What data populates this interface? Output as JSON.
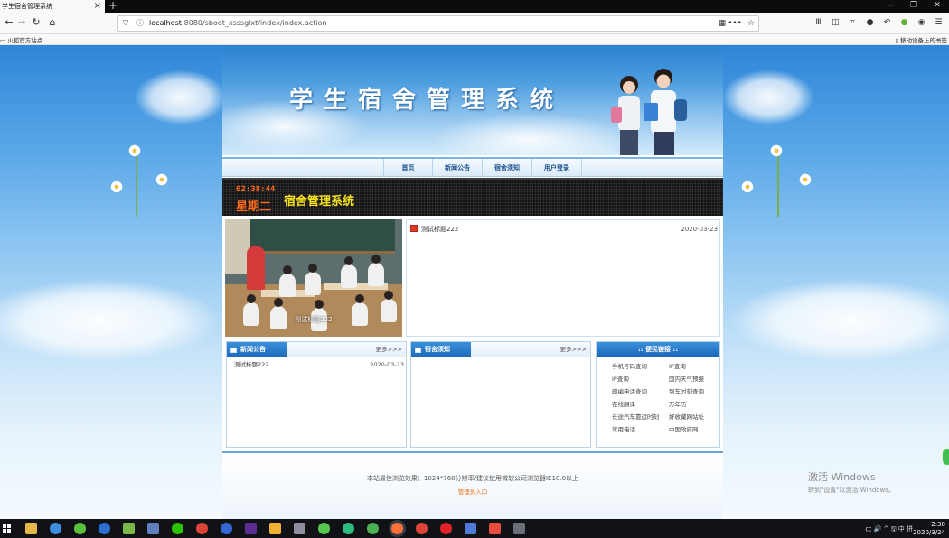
{
  "browser": {
    "tab_title": "学生宿舍管理系统",
    "tab_close": "×",
    "new_tab": "+",
    "window_controls": [
      "—",
      "❐",
      "✕"
    ],
    "nav_icons": [
      "back-icon",
      "forward-icon",
      "reload-icon",
      "home-icon"
    ],
    "url_host": "localhost",
    "url_rest": ":8080/sboot_xsssglxt/index/index.action",
    "url_right_icons": [
      "qr-code-icon",
      "page-actions-icon",
      "bookmark-star-icon"
    ],
    "toolbar_icons": [
      "library-icon",
      "sidebar-icon",
      "screenshot-icon",
      "chat-icon",
      "undo-icon",
      "extension-icon",
      "account-icon",
      "menu-icon"
    ],
    "bookmark_left": "火狐官方站点",
    "bookmark_right": "移动设备上的书签"
  },
  "site": {
    "banner_title": "学生宿舍管理系统",
    "menu": [
      "首页",
      "新闻公告",
      "宿舍须知",
      "用户登录"
    ],
    "clock": {
      "time": "02:38:44",
      "weekday": "星期二",
      "system_name": "宿舍管理系统"
    },
    "slideshow_caption": "测试标题222",
    "top_news": [
      {
        "title": "测试标题222",
        "date": "2020-03-23"
      }
    ],
    "news_panel": {
      "title": "新闻公告",
      "more": "更多>>>",
      "items": [
        {
          "title": "测试标题222",
          "date": "2020-03-23"
        }
      ]
    },
    "notice_panel": {
      "title": "宿舍须知",
      "more": "更多>>>",
      "items": []
    },
    "links_panel": {
      "title": ":: 便民链接 ::",
      "links": [
        "手机号码查询",
        "IP查询",
        "IP查询",
        "国内天气预报",
        "邮编电话查询",
        "列车时刻查询",
        "在线翻译",
        "万年历",
        "长途汽车靠运时刻",
        "好收藏网站址",
        "常用电话",
        "中国政府网"
      ]
    },
    "footer": {
      "line1": "本站最佳浏览效果：1024*768分辨率/建议使用微软公司浏览器IE10.0以上",
      "admin_link": "管理员入口"
    }
  },
  "overlay": {
    "activate_title": "激活 Windows",
    "activate_hint": "转到\"设置\"以激活 Windows。"
  },
  "taskbar": {
    "time": "2:38",
    "date": "2020/3/24",
    "tray_text": "㏄ 🔊 ^ 🖫 中 拼"
  },
  "colors": {
    "accent_blue": "#1c68b8",
    "clock_orange": "#ff6a1a",
    "clock_yellow": "#f5e11d",
    "admin_link": "#e8741e"
  }
}
